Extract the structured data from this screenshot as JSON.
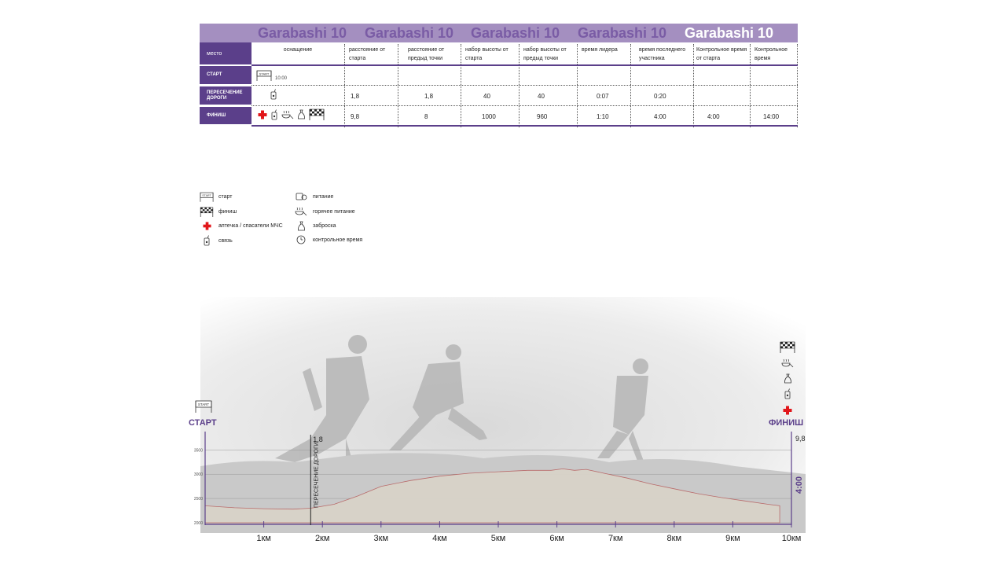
{
  "banner": {
    "text": "Garabashi 10"
  },
  "table": {
    "headers": {
      "place": "место",
      "equipment": "оснащение",
      "dist_start": "расстояние от старта",
      "dist_prev": "расстояние от предыд точки",
      "gain_start": "набор высоты от старта",
      "gain_prev": "набор высоты от предыд точки",
      "leader": "время лидера",
      "last": "время последнего участника",
      "cutoff": "Контрольное время от старта",
      "cutoff2": "Контрольное время"
    },
    "rows": [
      {
        "place": "СТАРТ",
        "equip_icons": [
          "start-flag"
        ],
        "equip_time": "10:00",
        "dist_start": "",
        "dist_prev": "",
        "gain_start": "",
        "gain_prev": "",
        "leader": "",
        "last": "",
        "cutoff": "",
        "cutoff2": ""
      },
      {
        "place": "ПЕРЕСЕЧЕНИЕ ДОРОГИ",
        "equip_icons": [
          "radio"
        ],
        "equip_time": "",
        "dist_start": "1,8",
        "dist_prev": "1,8",
        "gain_start": "40",
        "gain_prev": "40",
        "leader": "0:07",
        "last": "0:20",
        "cutoff": "",
        "cutoff2": ""
      },
      {
        "place": "ФИНИШ",
        "equip_icons": [
          "first-aid",
          "radio",
          "hot-food",
          "drop-bag",
          "finish-flag"
        ],
        "equip_time": "",
        "dist_start": "9,8",
        "dist_prev": "8",
        "gain_start": "1000",
        "gain_prev": "960",
        "leader": "1:10",
        "last": "4:00",
        "cutoff": "4:00",
        "cutoff2": "14:00"
      }
    ]
  },
  "legend": {
    "start": "старт",
    "finish": "финиш",
    "aid": "аптечка / спасатели МЧС",
    "radio": "связь",
    "food": "питание",
    "hot_food": "горячее питание",
    "drop": "заброска",
    "cutoff": "контрольное время"
  },
  "profile": {
    "start_label": "СТАРТ",
    "finish_label": "ФИНИШ",
    "finish_km_label": "9,8",
    "finish_cutoff": "4:00",
    "checkpoint_km": "1,8",
    "checkpoint_label": "ПЕРЕСЕЧЕНИЕ ДОРОГИ",
    "finish_icons": [
      "finish-flag",
      "hot-food",
      "drop-bag",
      "radio",
      "first-aid"
    ]
  },
  "chart_data": {
    "type": "area",
    "title": "",
    "xlabel": "",
    "ylabel": "",
    "xlim": [
      0,
      10
    ],
    "ylim": [
      2000,
      3700
    ],
    "x_ticks": [
      "1км",
      "2км",
      "3км",
      "4км",
      "5км",
      "6км",
      "7км",
      "8км",
      "9км",
      "10км"
    ],
    "y_ticks": [
      2000,
      2500,
      3000,
      3500
    ],
    "x": [
      0,
      0.5,
      1.0,
      1.5,
      1.8,
      2.2,
      2.6,
      3.0,
      3.5,
      4.0,
      4.5,
      5.0,
      5.5,
      5.9,
      6.1,
      6.3,
      6.5,
      6.8,
      7.2,
      7.6,
      8.0,
      8.4,
      8.8,
      9.2,
      9.6,
      9.8
    ],
    "y": [
      2350,
      2310,
      2290,
      2280,
      2300,
      2380,
      2550,
      2750,
      2870,
      2960,
      3020,
      3050,
      3080,
      3080,
      3110,
      3080,
      3100,
      3020,
      2920,
      2800,
      2700,
      2600,
      2520,
      2450,
      2380,
      2350
    ],
    "grid": true
  },
  "colors": {
    "purple": "#5b3f8a",
    "banner": "#a48fc0",
    "banner_text": "#7a5ca5",
    "aid": "#e1161a",
    "terrain": "#d8d3c8",
    "terrain_line": "#b96b6b"
  }
}
